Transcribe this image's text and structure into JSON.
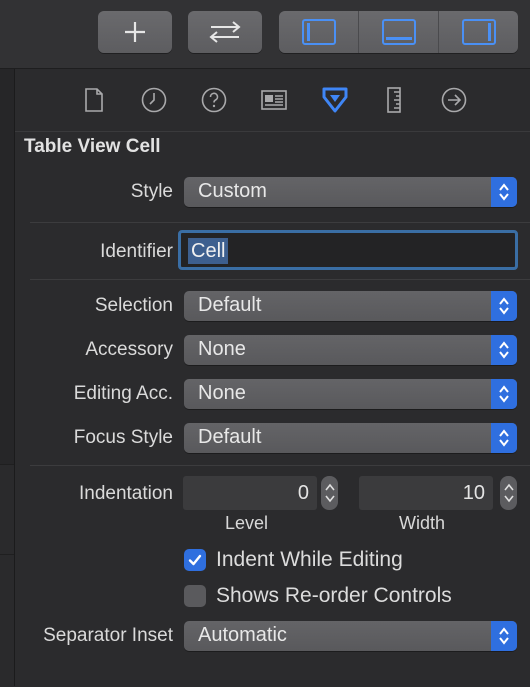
{
  "toolbar": {
    "add_icon": "plus-icon",
    "swap_icon": "swap-arrows-icon",
    "layout_icons": [
      "left-panel-icon",
      "bottom-panel-icon",
      "right-panel-icon"
    ]
  },
  "inspector_tabs": [
    "file-icon",
    "history-icon",
    "help-icon",
    "identity-icon",
    "attributes-icon",
    "size-ruler-icon",
    "connections-icon"
  ],
  "section": {
    "title": "Table View Cell"
  },
  "fields": {
    "style": {
      "label": "Style",
      "value": "Custom"
    },
    "identifier": {
      "label": "Identifier",
      "value": "Cell"
    },
    "selection": {
      "label": "Selection",
      "value": "Default"
    },
    "accessory": {
      "label": "Accessory",
      "value": "None"
    },
    "editing_acc": {
      "label": "Editing Acc.",
      "value": "None"
    },
    "focus_style": {
      "label": "Focus Style",
      "value": "Default"
    },
    "indentation": {
      "label": "Indentation",
      "level": "0",
      "level_label": "Level",
      "width": "10",
      "width_label": "Width"
    },
    "indent_while_editing": {
      "label": "Indent While Editing",
      "checked": true
    },
    "shows_reorder": {
      "label": "Shows Re-order Controls",
      "checked": false
    },
    "separator_inset": {
      "label": "Separator Inset",
      "value": "Automatic"
    }
  },
  "colors": {
    "accent": "#2f6fdf",
    "background": "#2b2b2d",
    "control": "#5f5f62"
  }
}
